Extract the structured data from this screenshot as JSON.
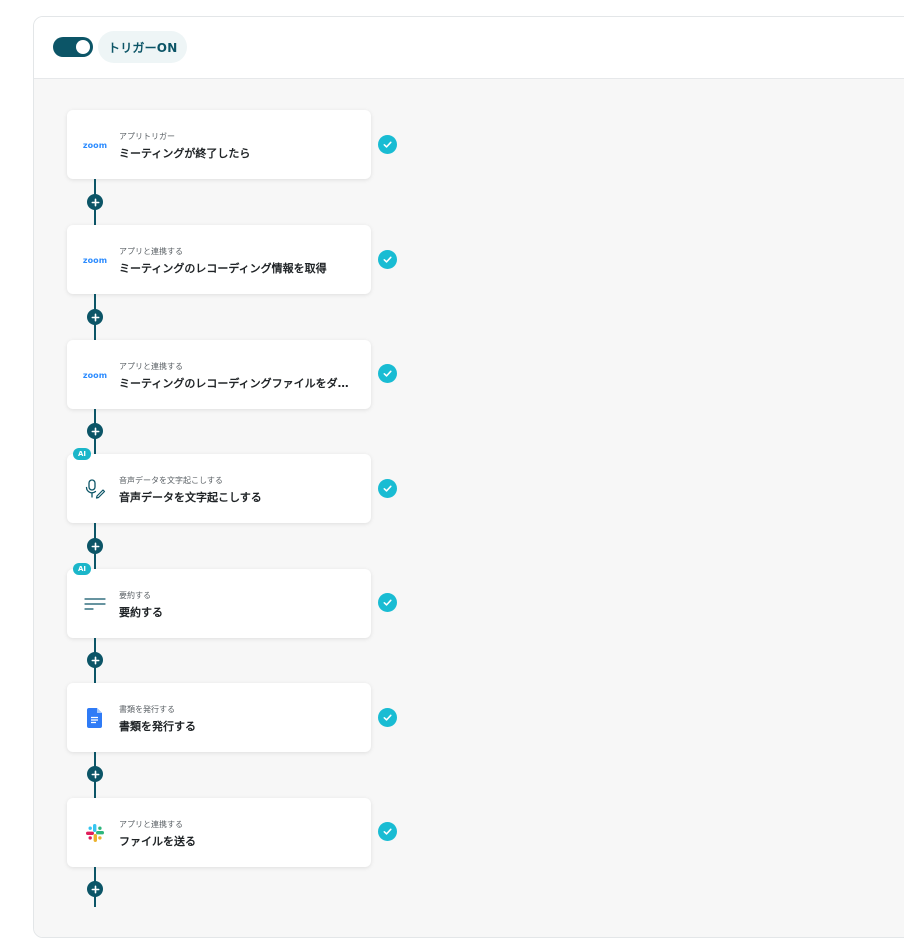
{
  "header": {
    "trigger_toggle": {
      "state": "on"
    },
    "trigger_label": "トリガーON"
  },
  "colors": {
    "toggle": "#0c5567",
    "connector": "#0c5567",
    "check": "#19bcd3",
    "ai_badge": "#1bb6c9",
    "zoom": "#2d8cff",
    "docs": "#2f7bf6"
  },
  "steps": [
    {
      "icon": "zoom-logo",
      "icon_text": "zoom",
      "sub": "アプリトリガー",
      "title": "ミーティングが終了したら",
      "status": "check-icon"
    },
    {
      "icon": "zoom-logo",
      "icon_text": "zoom",
      "sub": "アプリと連携する",
      "title": "ミーティングのレコーディング情報を取得",
      "status": "check-icon"
    },
    {
      "icon": "zoom-logo",
      "icon_text": "zoom",
      "sub": "アプリと連携する",
      "title": "ミーティングのレコーディングファイルをダ…",
      "status": "check-icon"
    },
    {
      "icon": "microphone-pen-icon",
      "badge": "AI",
      "sub": "音声データを文字起こしする",
      "title": "音声データを文字起こしする",
      "status": "check-icon"
    },
    {
      "icon": "summary-lines-icon",
      "badge": "AI",
      "sub": "要約する",
      "title": "要約する",
      "status": "check-icon"
    },
    {
      "icon": "google-docs-icon",
      "sub": "書類を発行する",
      "title": "書類を発行する",
      "status": "check-icon"
    },
    {
      "icon": "slack-icon",
      "sub": "アプリと連携する",
      "title": "ファイルを送る",
      "status": "check-icon"
    }
  ]
}
